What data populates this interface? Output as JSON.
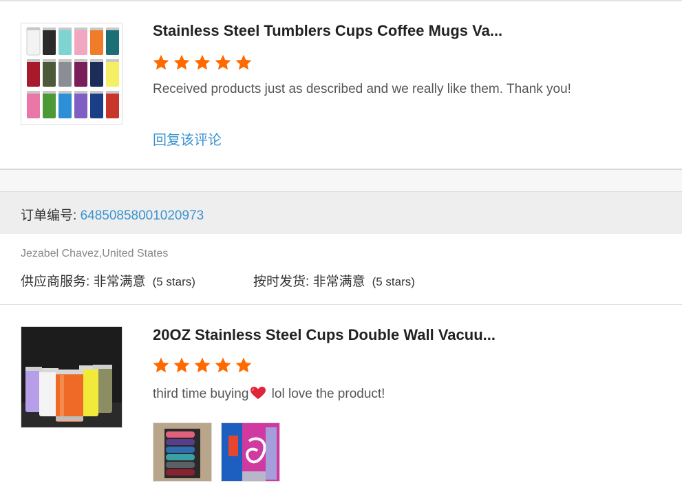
{
  "reviews": [
    {
      "product_title": "Stainless Steel Tumblers Cups Coffee Mugs Va...",
      "rating": 5,
      "text": "Received products just as described and we really like them. Thank you!",
      "reply_label": "回复该评论"
    },
    {
      "product_title": "20OZ Stainless Steel Cups Double Wall Vacuu...",
      "rating": 5,
      "text_before": "third time buying",
      "text_after": " lol love the product!",
      "photo_count": 2
    }
  ],
  "order": {
    "label": "订单编号: ",
    "number": "64850858001020973"
  },
  "feedback": {
    "customer": "Jezabel Chavez,United States",
    "supplier_service_label": "供应商服务: ",
    "supplier_service_value": "非常满意",
    "supplier_service_stars": "(5 stars)",
    "shipping_label": "按时发货: ",
    "shipping_value": "非常满意",
    "shipping_stars": "(5 stars)"
  },
  "colors": {
    "star": "#ff6a00",
    "link": "#3a93d0",
    "band": "#eeeeee"
  },
  "icons": [
    "star-icon",
    "heart-icon"
  ]
}
